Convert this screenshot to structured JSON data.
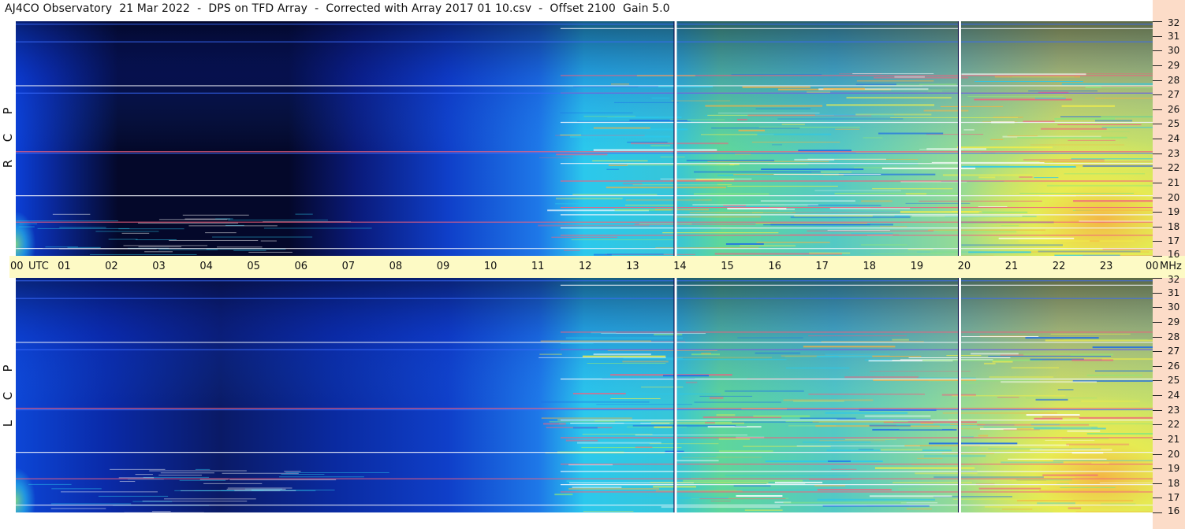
{
  "title": "AJ4CO Observatory  21 Mar 2022  -  DPS on TFD Array  -  Corrected with Array 2017 01 10.csv  -  Offset 2100  Gain 5.0",
  "panels": {
    "top_label": [
      "R",
      "C",
      "P"
    ],
    "bottom_label": [
      "L",
      "C",
      "P"
    ]
  },
  "colors": {
    "background": "#ffffff",
    "time_strip": "#fdfac5",
    "freq_strip": "#fcdcc8",
    "dark": "#04082a",
    "deep_blue": "#0a28b4",
    "blue": "#1c6be8",
    "cyan": "#2bc8ec",
    "green": "#8ee67a",
    "yellow": "#f1ee4a",
    "orange": "#f7b142",
    "pink": "#f2607e",
    "white_line": "#f6f8ff"
  },
  "chart_data": {
    "type": "heatmap",
    "title": "AJ4CO Observatory  21 Mar 2022  -  DPS on TFD Array  -  Corrected with Array 2017 01 10.csv  -  Offset 2100  Gain 5.0",
    "x_axis": {
      "unit_label": "UTC",
      "range": [
        0,
        24
      ],
      "tick_labels": [
        "00",
        "01",
        "02",
        "03",
        "04",
        "05",
        "06",
        "07",
        "08",
        "09",
        "10",
        "11",
        "12",
        "13",
        "14",
        "15",
        "16",
        "17",
        "18",
        "19",
        "20",
        "21",
        "22",
        "23",
        "00"
      ]
    },
    "y_axis": {
      "unit_label": "MHz",
      "range": [
        16,
        32
      ],
      "tick_labels": [
        "32",
        "31",
        "30",
        "29",
        "28",
        "27",
        "26",
        "25",
        "24",
        "23",
        "22",
        "21",
        "20",
        "19",
        "18",
        "17",
        "16"
      ]
    },
    "panels": [
      "RCP",
      "LCP"
    ],
    "colormap": [
      "#04082a",
      "#0a28b4",
      "#1c6be8",
      "#2bc8ec",
      "#8ee67a",
      "#f1ee4a",
      "#f7b142",
      "#f2607e"
    ],
    "vertical_markers_utc": [
      13.93,
      19.93
    ],
    "horizontal_interference_mhz": [
      16.5,
      17.4,
      17.9,
      18.3,
      18.8,
      19.3,
      20.1,
      21.1,
      22.3,
      23.1,
      25.1,
      27.1,
      27.6,
      28.3,
      31.5
    ]
  },
  "ticks": {
    "utc_word": "UTC",
    "mhz_word": "MHz"
  }
}
